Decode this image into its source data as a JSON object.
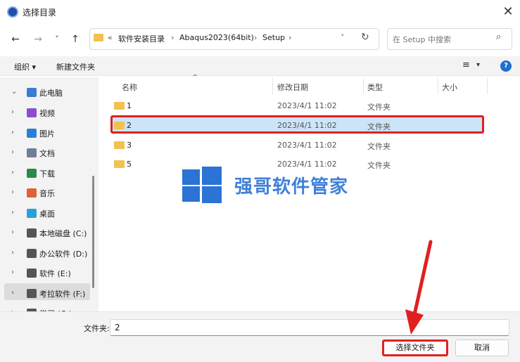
{
  "window": {
    "title": "选择目录",
    "close_glyph": "✕"
  },
  "nav": {
    "back_glyph": "←",
    "forward_glyph": "→",
    "recent_glyph": "˅",
    "up_glyph": "↑"
  },
  "address": {
    "overflow": "«",
    "crumbs": [
      "软件安装目录",
      "Abaqus2023(64bit)",
      "Setup"
    ],
    "separator": "›",
    "dropdown_glyph": "˅",
    "refresh_glyph": "↻"
  },
  "search": {
    "placeholder": "在 Setup 中搜索",
    "icon_glyph": "⌕"
  },
  "toolbar": {
    "organize_label": "组织 ▾",
    "new_folder_label": "新建文件夹",
    "view_glyph": "≡",
    "view_dropdown_glyph": "▾",
    "help_glyph": "?"
  },
  "sidebar": {
    "items": [
      {
        "label": "此电脑",
        "chevron": "⌄",
        "icon": "computer-icon",
        "color": "#3a7bd5"
      },
      {
        "label": "视频",
        "chevron": "›",
        "icon": "video-icon",
        "color": "#8a4fd1"
      },
      {
        "label": "图片",
        "chevron": "›",
        "icon": "picture-icon",
        "color": "#2a7fd4"
      },
      {
        "label": "文档",
        "chevron": "›",
        "icon": "document-icon",
        "color": "#6f7f95"
      },
      {
        "label": "下载",
        "chevron": "›",
        "icon": "download-icon",
        "color": "#2a8a4a"
      },
      {
        "label": "音乐",
        "chevron": "›",
        "icon": "music-icon",
        "color": "#e0603a"
      },
      {
        "label": "桌面",
        "chevron": "›",
        "icon": "desktop-icon",
        "color": "#2aa0d8"
      },
      {
        "label": "本地磁盘 (C:)",
        "chevron": "›",
        "icon": "drive-icon",
        "color": "#555555"
      },
      {
        "label": "办公软件 (D:)",
        "chevron": "›",
        "icon": "drive-icon",
        "color": "#555555"
      },
      {
        "label": "软件 (E:)",
        "chevron": "›",
        "icon": "drive-icon",
        "color": "#555555"
      },
      {
        "label": "考拉软件 (F:)",
        "chevron": "›",
        "icon": "drive-icon",
        "color": "#555555"
      },
      {
        "label": "学习 (G:)",
        "chevron": "›",
        "icon": "drive-icon",
        "color": "#555555"
      }
    ]
  },
  "columns": {
    "name": "名称",
    "modified": "修改日期",
    "type": "类型",
    "size": "大小",
    "sort_glyph": "^"
  },
  "files": [
    {
      "name": "1",
      "modified": "2023/4/1 11:02",
      "type": "文件夹"
    },
    {
      "name": "2",
      "modified": "2023/4/1 11:02",
      "type": "文件夹"
    },
    {
      "name": "3",
      "modified": "2023/4/1 11:02",
      "type": "文件夹"
    },
    {
      "name": "5",
      "modified": "2023/4/1 11:02",
      "type": "文件夹"
    }
  ],
  "watermark": {
    "text": "强哥软件管家"
  },
  "bottom": {
    "folder_label": "文件夹:",
    "folder_value": "2",
    "select_button": "选择文件夹",
    "cancel_button": "取消"
  },
  "colors": {
    "highlight_red": "#e02020",
    "selection_blue": "#cce4f7",
    "folder_yellow": "#f2c14e",
    "watermark_blue": "#2b73d4"
  }
}
